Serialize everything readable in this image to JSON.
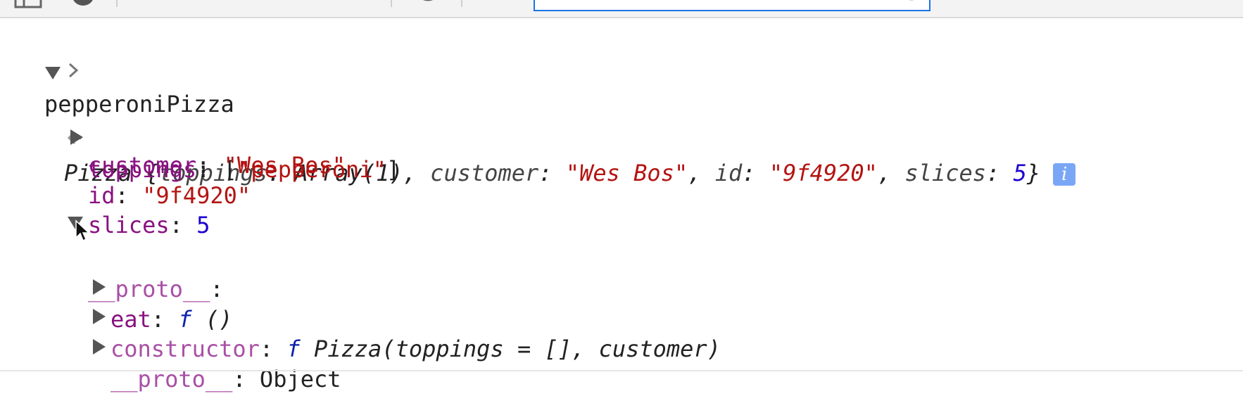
{
  "console": {
    "input_prompt": ">",
    "input_text": "pepperoniPizza",
    "result_prompt": "<·",
    "summary": {
      "class_name": "Pizza",
      "open_brace": " {",
      "prop1_key": "toppings",
      "prop1_value": "Array(1)",
      "prop2_key": "customer",
      "prop2_value": "\"Wes Bos\"",
      "prop3_key": "id",
      "prop3_value": "\"9f4920\"",
      "prop4_key": "slices",
      "prop4_value": "5",
      "close_brace": "}",
      "info_badge": "i"
    },
    "properties": [
      {
        "key": "toppings",
        "value_open": "[",
        "value": "\"pepperoni\"",
        "value_close": "]"
      },
      {
        "key": "customer",
        "value": "\"Wes Bos\""
      },
      {
        "key": "id",
        "value": "\"9f4920\""
      },
      {
        "key": "slices",
        "value": "5"
      }
    ],
    "proto": {
      "key": "__proto__",
      "children": [
        {
          "key": "eat",
          "fn_keyword": "f",
          "signature": " ()"
        },
        {
          "key": "constructor",
          "fn_keyword": "f",
          "signature": " Pizza(toppings = [], customer)"
        },
        {
          "key": "__proto__",
          "value": "Object"
        }
      ]
    }
  },
  "icons": {
    "prompt": "chevron-right-icon",
    "result": "return-arrow-icon",
    "expanded": "triangle-down-icon",
    "collapsed": "triangle-right-icon",
    "pointer": "mouse-cursor-icon",
    "info": "info-icon"
  },
  "colors": {
    "key": "#881280",
    "string": "#b31412",
    "number": "#1c00cf",
    "function": "#0d22aa",
    "filter_border": "#1a73e8"
  }
}
